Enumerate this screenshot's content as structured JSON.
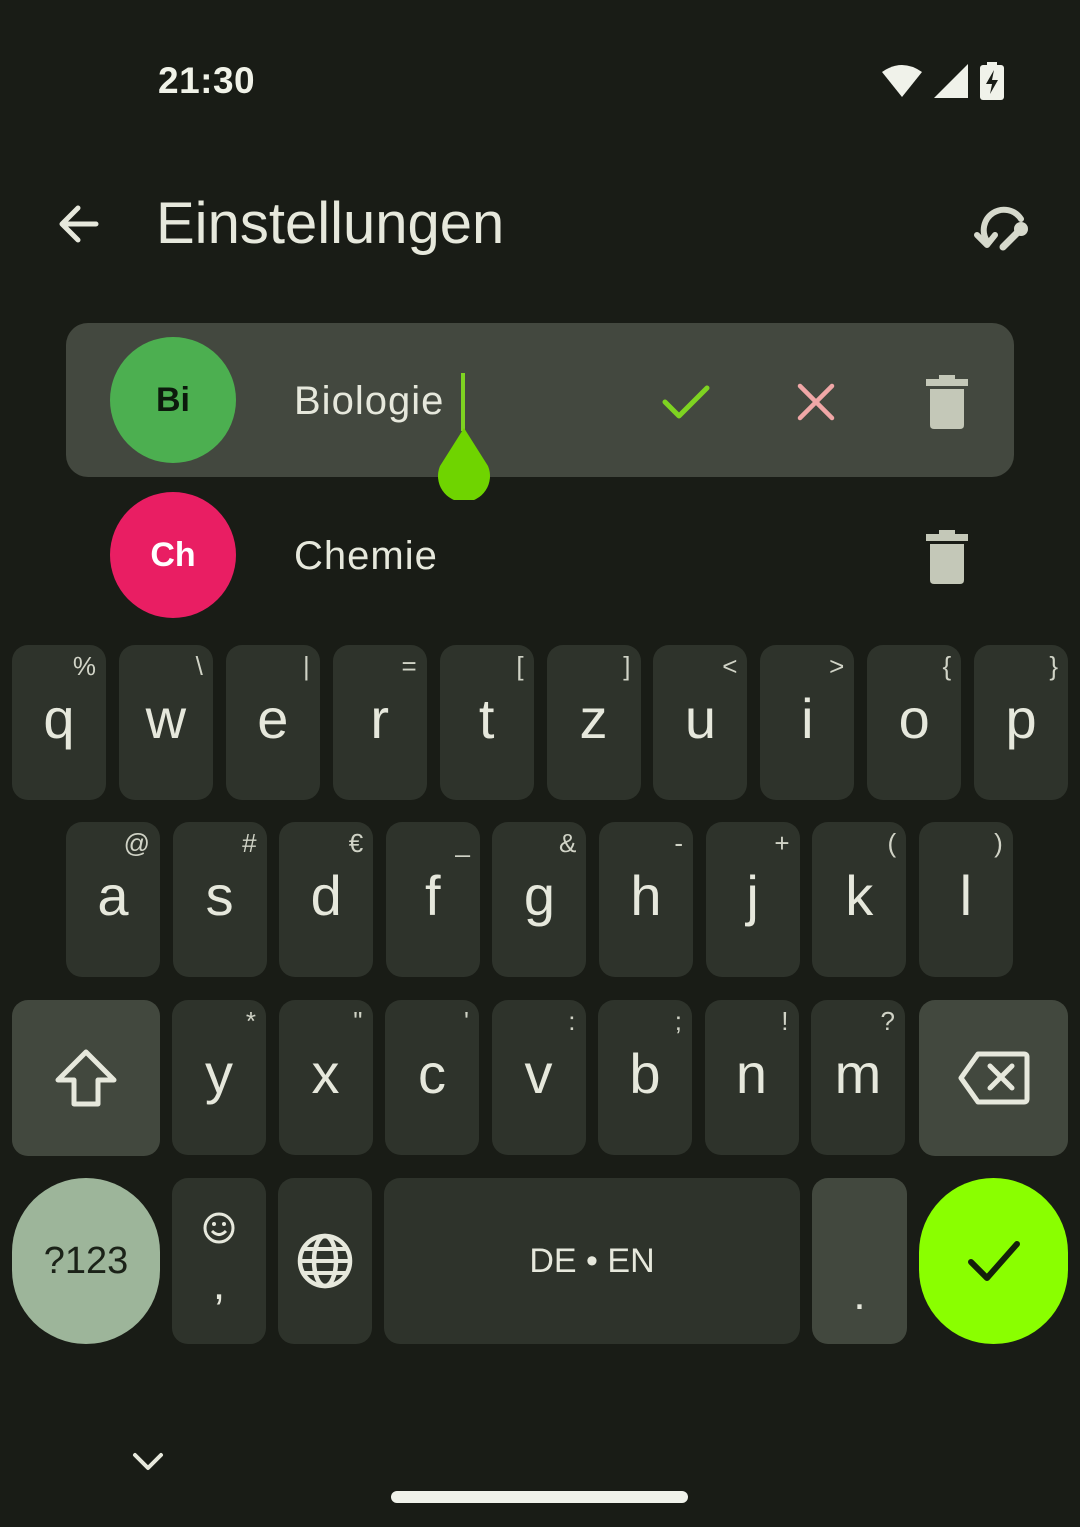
{
  "status_bar": {
    "time": "21:30"
  },
  "app_bar": {
    "title": "Einstellungen"
  },
  "subjects": [
    {
      "abbr": "Bi",
      "name": "Biologie",
      "color": "#4caf50",
      "text_color": "#0c1a0c",
      "editing": true
    },
    {
      "abbr": "Ch",
      "name": "Chemie",
      "color": "#e91e63",
      "text_color": "#ffffff",
      "editing": false
    }
  ],
  "keyboard": {
    "row1": [
      {
        "key": "q",
        "hint": "%"
      },
      {
        "key": "w",
        "hint": "\\"
      },
      {
        "key": "e",
        "hint": "|"
      },
      {
        "key": "r",
        "hint": "="
      },
      {
        "key": "t",
        "hint": "["
      },
      {
        "key": "z",
        "hint": "]"
      },
      {
        "key": "u",
        "hint": "<"
      },
      {
        "key": "i",
        "hint": ">"
      },
      {
        "key": "o",
        "hint": "{"
      },
      {
        "key": "p",
        "hint": "}"
      }
    ],
    "row2": [
      {
        "key": "a",
        "hint": "@"
      },
      {
        "key": "s",
        "hint": "#"
      },
      {
        "key": "d",
        "hint": "€"
      },
      {
        "key": "f",
        "hint": "_"
      },
      {
        "key": "g",
        "hint": "&"
      },
      {
        "key": "h",
        "hint": "-"
      },
      {
        "key": "j",
        "hint": "+"
      },
      {
        "key": "k",
        "hint": "("
      },
      {
        "key": "l",
        "hint": ")"
      }
    ],
    "row3": [
      {
        "key": "y",
        "hint": "*"
      },
      {
        "key": "x",
        "hint": "\""
      },
      {
        "key": "c",
        "hint": "'"
      },
      {
        "key": "v",
        "hint": ":"
      },
      {
        "key": "b",
        "hint": ";"
      },
      {
        "key": "n",
        "hint": "!"
      },
      {
        "key": "m",
        "hint": "?"
      }
    ],
    "symbols_label": "?123",
    "comma_label": ",",
    "space_label": "DE • EN",
    "period_label": ".",
    "accent_color": "#8aff00",
    "icons": [
      "shift-icon",
      "backspace-icon",
      "emoji-icon",
      "globe-icon",
      "checkmark-icon",
      "chevron-down-icon"
    ]
  }
}
